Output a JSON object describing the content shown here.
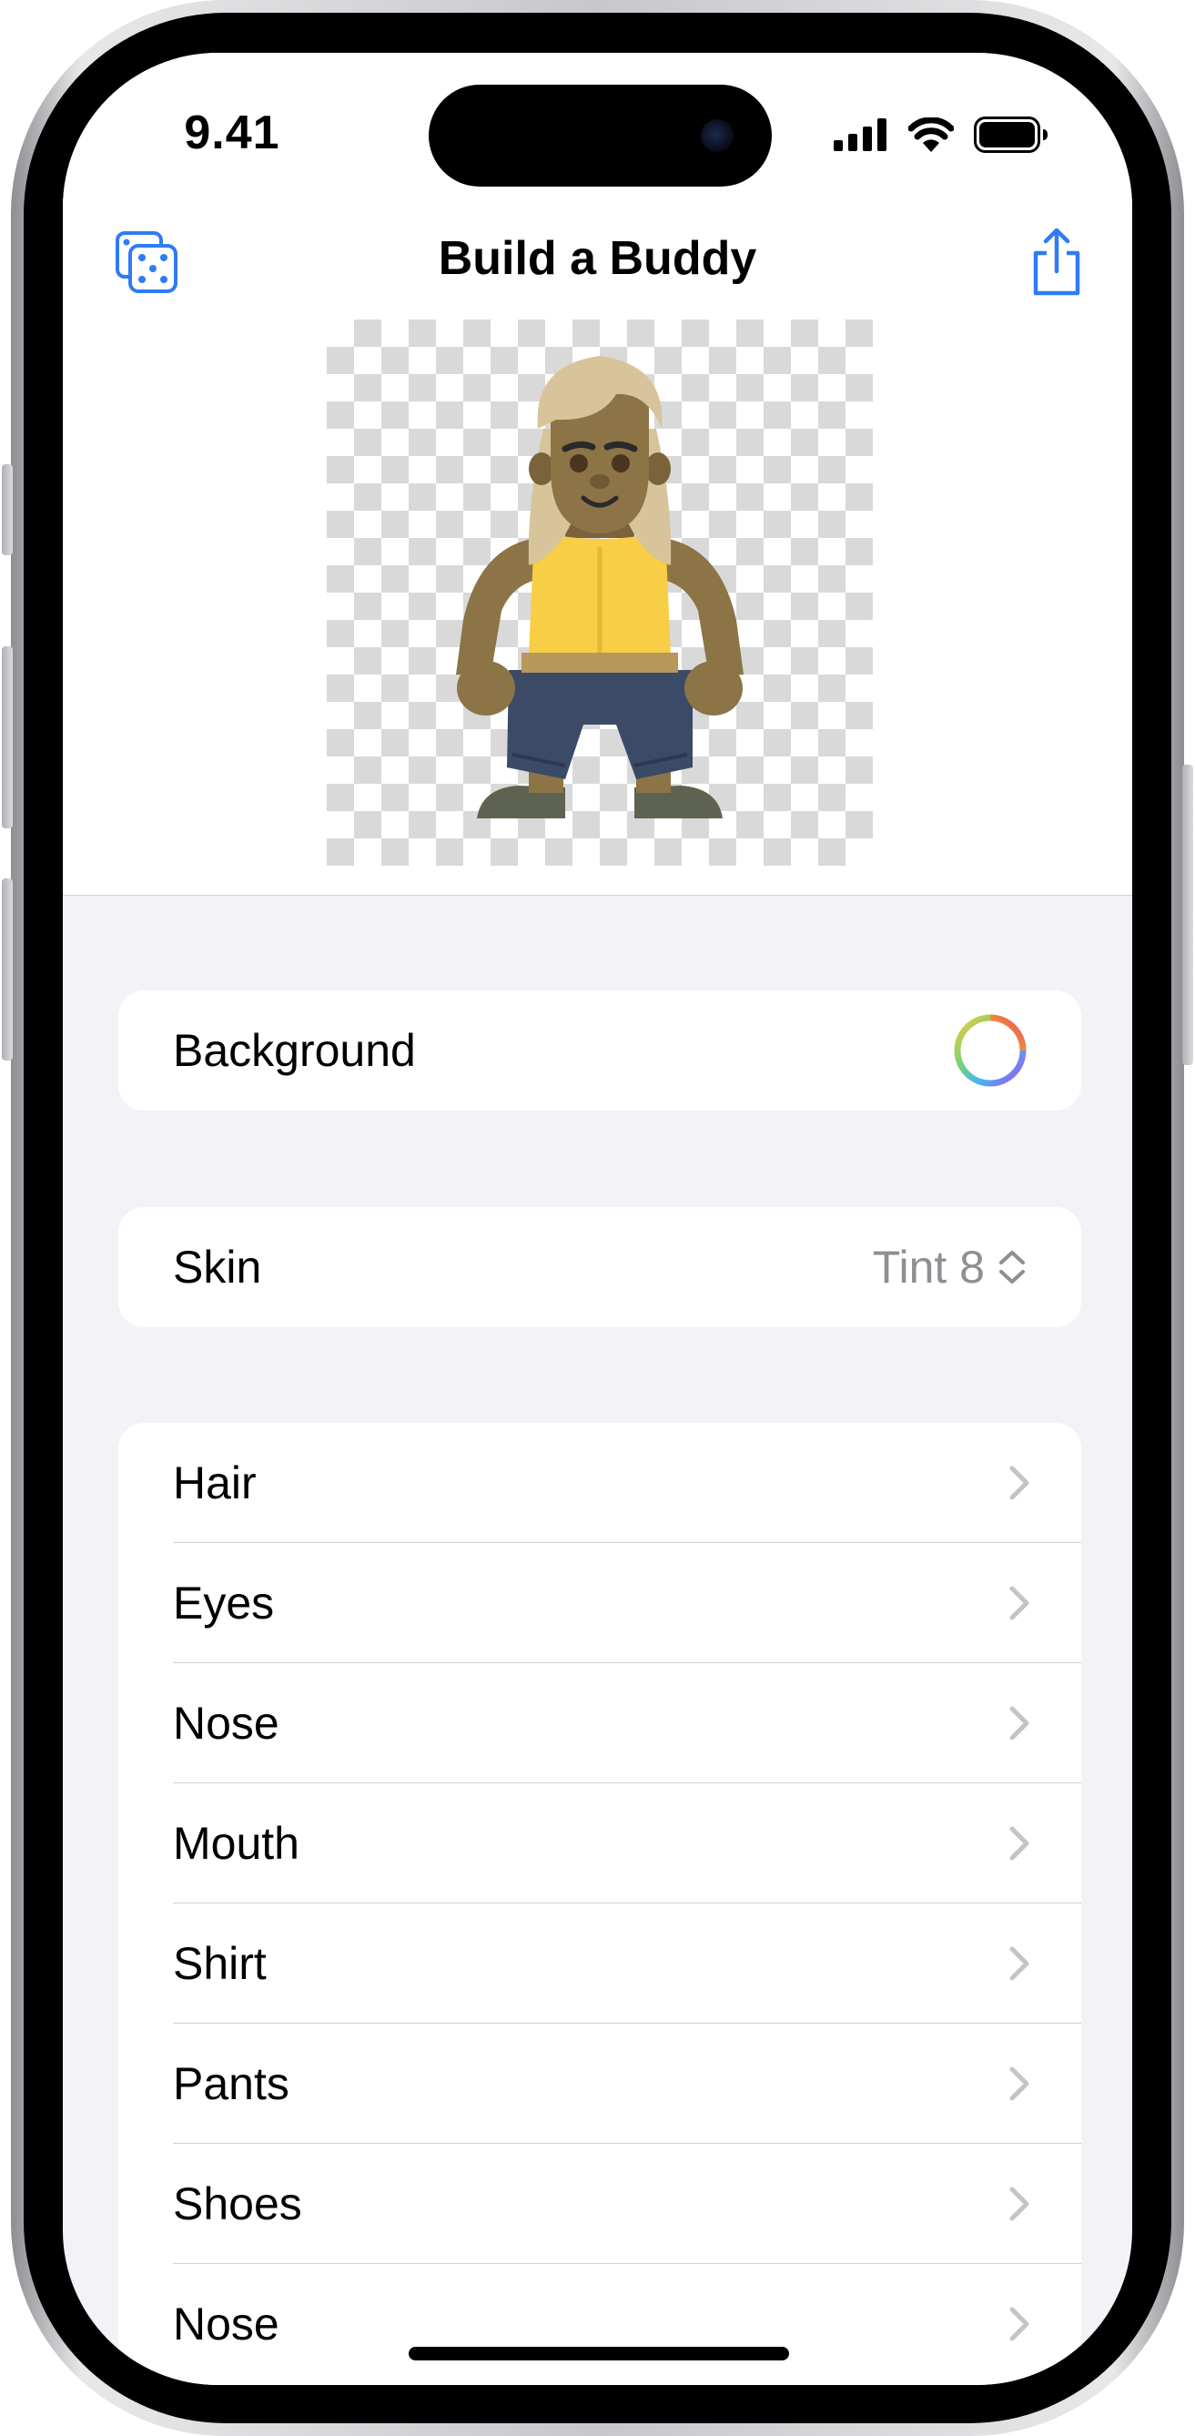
{
  "status_bar": {
    "time": "9.41"
  },
  "nav": {
    "title": "Build a Buddy",
    "left_icon": "dice-icon",
    "right_icon": "share-icon",
    "accent_color": "#2f7bf5"
  },
  "settings": {
    "background": {
      "label": "Background",
      "icon": "color-wheel-icon"
    },
    "skin": {
      "label": "Skin",
      "value": "Tint 8",
      "icon": "up-down-chevron-icon"
    },
    "features": [
      {
        "label": "Hair"
      },
      {
        "label": "Eyes"
      },
      {
        "label": "Nose"
      },
      {
        "label": "Mouth"
      },
      {
        "label": "Shirt"
      },
      {
        "label": "Pants"
      },
      {
        "label": "Shoes"
      },
      {
        "label": "Nose"
      }
    ]
  },
  "colors": {
    "list_background": "#f2f2f7",
    "secondary_text": "#8e8e93",
    "chevron": "#c4c4c7",
    "buddy_skin": "#8c7446",
    "buddy_hair": "#d8c49a",
    "buddy_shirt": "#f7ce46",
    "buddy_pants": "#3b4a66",
    "buddy_shoes": "#5e6250"
  }
}
